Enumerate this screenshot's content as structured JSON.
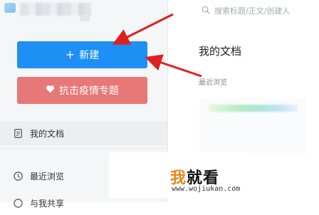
{
  "search": {
    "placeholder": "搜索标题/正文/创建人"
  },
  "sidebar": {
    "new_button": "新建",
    "covid_button": "抗击疫情专题",
    "items": [
      {
        "label": "我的文档"
      },
      {
        "label": "最近浏览"
      },
      {
        "label": "与我共享"
      }
    ]
  },
  "main": {
    "title": "我的文档",
    "recent_label": "最近浏览"
  },
  "watermark": {
    "logo_accent": "我",
    "logo_rest": "就看",
    "url": "www.wojiukan.com"
  },
  "colors": {
    "primary": "#1e8ff5",
    "covid": "#e87778",
    "arrow": "#e02020"
  }
}
